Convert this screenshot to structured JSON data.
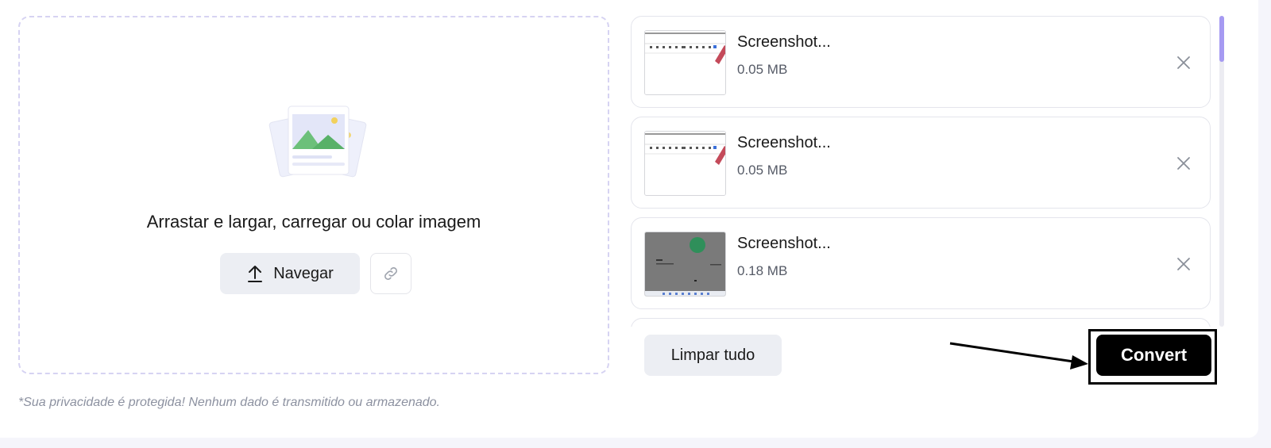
{
  "dropzone": {
    "instruction": "Arrastar e largar, carregar ou colar imagem",
    "browse_label": "Navegar",
    "illustration_icon": "images-stack-icon",
    "link_icon": "link-icon",
    "upload_icon": "upload-arrow-icon"
  },
  "privacy_note": "*Sua privacidade é protegida! Nenhum dado é transmitido ou armazenado.",
  "files": [
    {
      "name": "Screenshot...",
      "size": "0.05 MB",
      "thumb": "toolbar-screenshot"
    },
    {
      "name": "Screenshot...",
      "size": "0.05 MB",
      "thumb": "toolbar-screenshot"
    },
    {
      "name": "Screenshot...",
      "size": "0.18 MB",
      "thumb": "dark-screenshot"
    }
  ],
  "actions": {
    "clear_all_label": "Limpar tudo",
    "convert_label": "Convert"
  },
  "colors": {
    "accent": "#a69af2",
    "dashed_border": "#d6d3f2",
    "primary_button": "#000000"
  }
}
